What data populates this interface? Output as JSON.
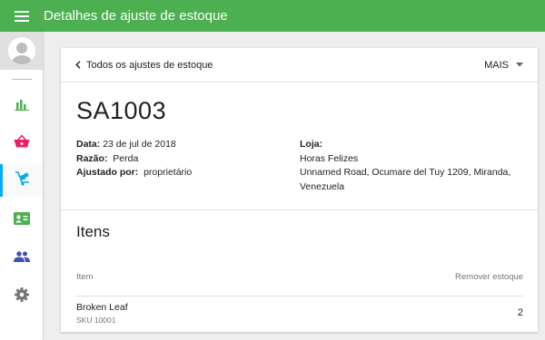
{
  "header": {
    "title": "Detalhes de ajuste de estoque",
    "menu_icon": "hamburger-menu-icon"
  },
  "sidebar": {
    "items": [
      {
        "name": "reports",
        "icon": "bar-chart-icon",
        "color": "#4caf50"
      },
      {
        "name": "sales",
        "icon": "basket-icon",
        "color": "#e91e63"
      },
      {
        "name": "inventory",
        "icon": "inventory-cart-icon",
        "color": "#03a9f4",
        "active": true
      },
      {
        "name": "customers",
        "icon": "id-card-icon",
        "color": "#4caf50"
      },
      {
        "name": "employees",
        "icon": "people-icon",
        "color": "#3f51b5"
      },
      {
        "name": "settings",
        "icon": "gear-icon",
        "color": "#757575"
      }
    ]
  },
  "card": {
    "back_label": "Todos os ajustes de estoque",
    "more_label": "MAIS",
    "doc_number": "SA1003",
    "date_label": "Data:",
    "date_value": "23 de jul de 2018",
    "reason_label": "Razão:",
    "reason_value": "Perda",
    "adjusted_label": "Ajustado por:",
    "adjusted_value": "proprietário",
    "store_label": "Loja:",
    "store_name": "Horas Felizes",
    "store_address": "Unnamed Road, Ocumare del Tuy 1209, Miranda, Venezuela"
  },
  "items": {
    "title": "Itens",
    "col_item": "Item",
    "col_remove": "Remover estoque",
    "rows": [
      {
        "name": "Broken Leaf",
        "sku": "SKU 10001",
        "qty": "2"
      }
    ]
  }
}
